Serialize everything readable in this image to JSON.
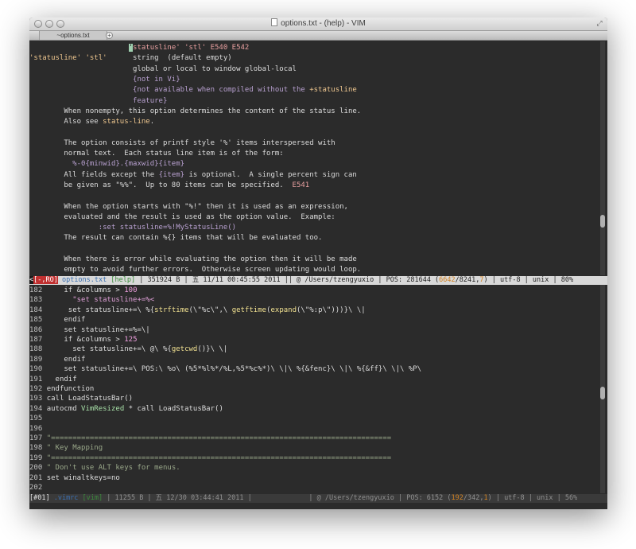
{
  "window": {
    "title": "options.txt - (help) - VIM",
    "tab_label": "~options.txt",
    "tab_add": "+"
  },
  "help_pane": {
    "lines": [
      [
        {
          "t": "                       "
        },
        {
          "t": "'",
          "c": "c-cursor"
        },
        {
          "t": "statusline' 'stl' E540 E542",
          "c": "c-tag"
        }
      ],
      [
        {
          "t": "'statusline' 'stl'",
          "c": "c-opt"
        },
        {
          "t": "      string  (default empty)"
        }
      ],
      [
        {
          "t": "                        global or local to window global-local"
        }
      ],
      [
        {
          "t": "                        {not in Vi}",
          "c": "c-sp"
        }
      ],
      [
        {
          "t": "                        {not available when compiled without the ",
          "c": "c-sp"
        },
        {
          "t": "+statusline",
          "c": "c-opt"
        }
      ],
      [
        {
          "t": "                        feature}",
          "c": "c-sp"
        }
      ],
      [
        {
          "t": "        When nonempty, this option determines the content of the status line."
        }
      ],
      [
        {
          "t": "        Also see "
        },
        {
          "t": "status-line",
          "c": "c-opt"
        },
        {
          "t": "."
        }
      ],
      [
        {
          "t": ""
        }
      ],
      [
        {
          "t": "        The option consists of printf style '%' items interspersed with"
        }
      ],
      [
        {
          "t": "        normal text.  Each status line item is of the form:"
        }
      ],
      [
        {
          "t": "          %-0{minwid}.{maxwid}{item}",
          "c": "c-sp"
        }
      ],
      [
        {
          "t": "        All fields except the "
        },
        {
          "t": "{item}",
          "c": "c-sp"
        },
        {
          "t": " is optional.  A single percent sign can"
        }
      ],
      [
        {
          "t": "        be given as \"%%\".  Up to 80 items can be specified.  "
        },
        {
          "t": "E541",
          "c": "c-tag"
        }
      ],
      [
        {
          "t": ""
        }
      ],
      [
        {
          "t": "        When the option starts with \"%!\" then it is used as an expression,"
        }
      ],
      [
        {
          "t": "        evaluated and the result is used as the option value.  Example:"
        }
      ],
      [
        {
          "t": "                :set statusline=%!MyStatusLine()",
          "c": "c-sp"
        }
      ],
      [
        {
          "t": "        The result can contain %{} items that will be evaluated too."
        }
      ],
      [
        {
          "t": ""
        }
      ],
      [
        {
          "t": "        When there is error while evaluating the option then it will be made"
        }
      ],
      [
        {
          "t": "        empty to avoid further errors.  Otherwise screen updating would loop."
        }
      ]
    ]
  },
  "status_top": [
    {
      "t": "<",
      "c": "c-st-dark"
    },
    {
      "t": "[-,RO]",
      "c": "c-st-red"
    },
    {
      "t": " options.txt",
      "c": "c-st-blue"
    },
    {
      "t": " [help]",
      "c": "c-st-green"
    },
    {
      "t": " | 351924 B | 五 11/11 00:45:55 2011 || @ /Users/tzengyuxio | POS: 281644 ("
    },
    {
      "t": "6642",
      "c": "c-st-orange"
    },
    {
      "t": "/8241,"
    },
    {
      "t": "7",
      "c": "c-st-orange"
    },
    {
      "t": ") | utf-8 | unix | 80%"
    }
  ],
  "code_pane": {
    "lines": [
      {
        "n": "182",
        "s": [
          {
            "t": "    if &columns > "
          },
          {
            "t": "100",
            "c": "c-num"
          }
        ]
      },
      {
        "n": "183",
        "s": [
          {
            "t": "      \"set statusline+=%<",
            "c": "c-str"
          }
        ]
      },
      {
        "n": "184",
        "s": [
          {
            "t": "     set statusline+=\\ %{"
          },
          {
            "t": "strftime",
            "c": "c-fn"
          },
          {
            "t": "(\\\"%c\\\",\\ "
          },
          {
            "t": "getftime",
            "c": "c-fn"
          },
          {
            "t": "("
          },
          {
            "t": "expand",
            "c": "c-fn"
          },
          {
            "t": "(\\\"%:p\\\")))}\\ \\|"
          }
        ]
      },
      {
        "n": "185",
        "s": [
          {
            "t": "    endif"
          }
        ]
      },
      {
        "n": "186",
        "s": [
          {
            "t": "    set statusline+=%=\\|"
          }
        ]
      },
      {
        "n": "187",
        "s": [
          {
            "t": "    if &columns > "
          },
          {
            "t": "125",
            "c": "c-num"
          }
        ]
      },
      {
        "n": "188",
        "s": [
          {
            "t": "      set statusline+=\\ @\\ %{"
          },
          {
            "t": "getcwd",
            "c": "c-fn"
          },
          {
            "t": "()}\\ \\|"
          }
        ]
      },
      {
        "n": "189",
        "s": [
          {
            "t": "    endif"
          }
        ]
      },
      {
        "n": "190",
        "s": [
          {
            "t": "    set statusline+=\\ POS:\\ %o\\ (%5*%l%*/%L,%5*%c%*)\\ \\|\\ %{&fenc}\\ \\|\\ %{&ff}\\ \\|\\ %P\\"
          }
        ]
      },
      {
        "n": "191",
        "s": [
          {
            "t": "  endif"
          }
        ]
      },
      {
        "n": "192",
        "s": [
          {
            "t": "endfunction"
          }
        ]
      },
      {
        "n": "193",
        "s": [
          {
            "t": "call LoadStatusBar()"
          }
        ]
      },
      {
        "n": "194",
        "s": [
          {
            "t": "autocmd "
          },
          {
            "t": "VimResized",
            "c": "c-green"
          },
          {
            "t": " * call LoadStatusBar()"
          }
        ]
      },
      {
        "n": "195",
        "s": [
          {
            "t": ""
          }
        ]
      },
      {
        "n": "196",
        "s": [
          {
            "t": ""
          }
        ]
      },
      {
        "n": "197",
        "s": [
          {
            "t": "\"===============================================================================",
            "c": "c-cmt"
          }
        ]
      },
      {
        "n": "198",
        "s": [
          {
            "t": "\" Key Mapping",
            "c": "c-cmt"
          }
        ]
      },
      {
        "n": "199",
        "s": [
          {
            "t": "\"===============================================================================",
            "c": "c-cmt"
          }
        ]
      },
      {
        "n": "200",
        "s": [
          {
            "t": "\" Don't use ALT keys for menus.",
            "c": "c-cmt"
          }
        ]
      },
      {
        "n": "201",
        "s": [
          {
            "t": "set winaltkeys=no"
          }
        ]
      },
      {
        "n": "202",
        "s": [
          {
            "t": ""
          }
        ]
      }
    ]
  },
  "status_bottom": [
    {
      "t": "[#01]",
      "c": "c-sb-white"
    },
    {
      "t": " .vimrc",
      "c": "c-st-blue"
    },
    {
      "t": " [vim]",
      "c": "c-st-green"
    },
    {
      "t": " | 11255 B | 五 12/30 03:44:41 2011 |              | @ /Users/tzengyuxio | POS: 6152 ("
    },
    {
      "t": "192",
      "c": "c-st-orange"
    },
    {
      "t": "/342,"
    },
    {
      "t": "1",
      "c": "c-st-orange"
    },
    {
      "t": ") | utf-8 | unix | 56%"
    }
  ],
  "colors": {
    "background": "#2b2b2b",
    "status_active_bg": "#d8d8d8",
    "status_inactive_bg": "#3a3a3a",
    "accent_red": "#c03030",
    "accent_blue": "#3a6fb0"
  }
}
